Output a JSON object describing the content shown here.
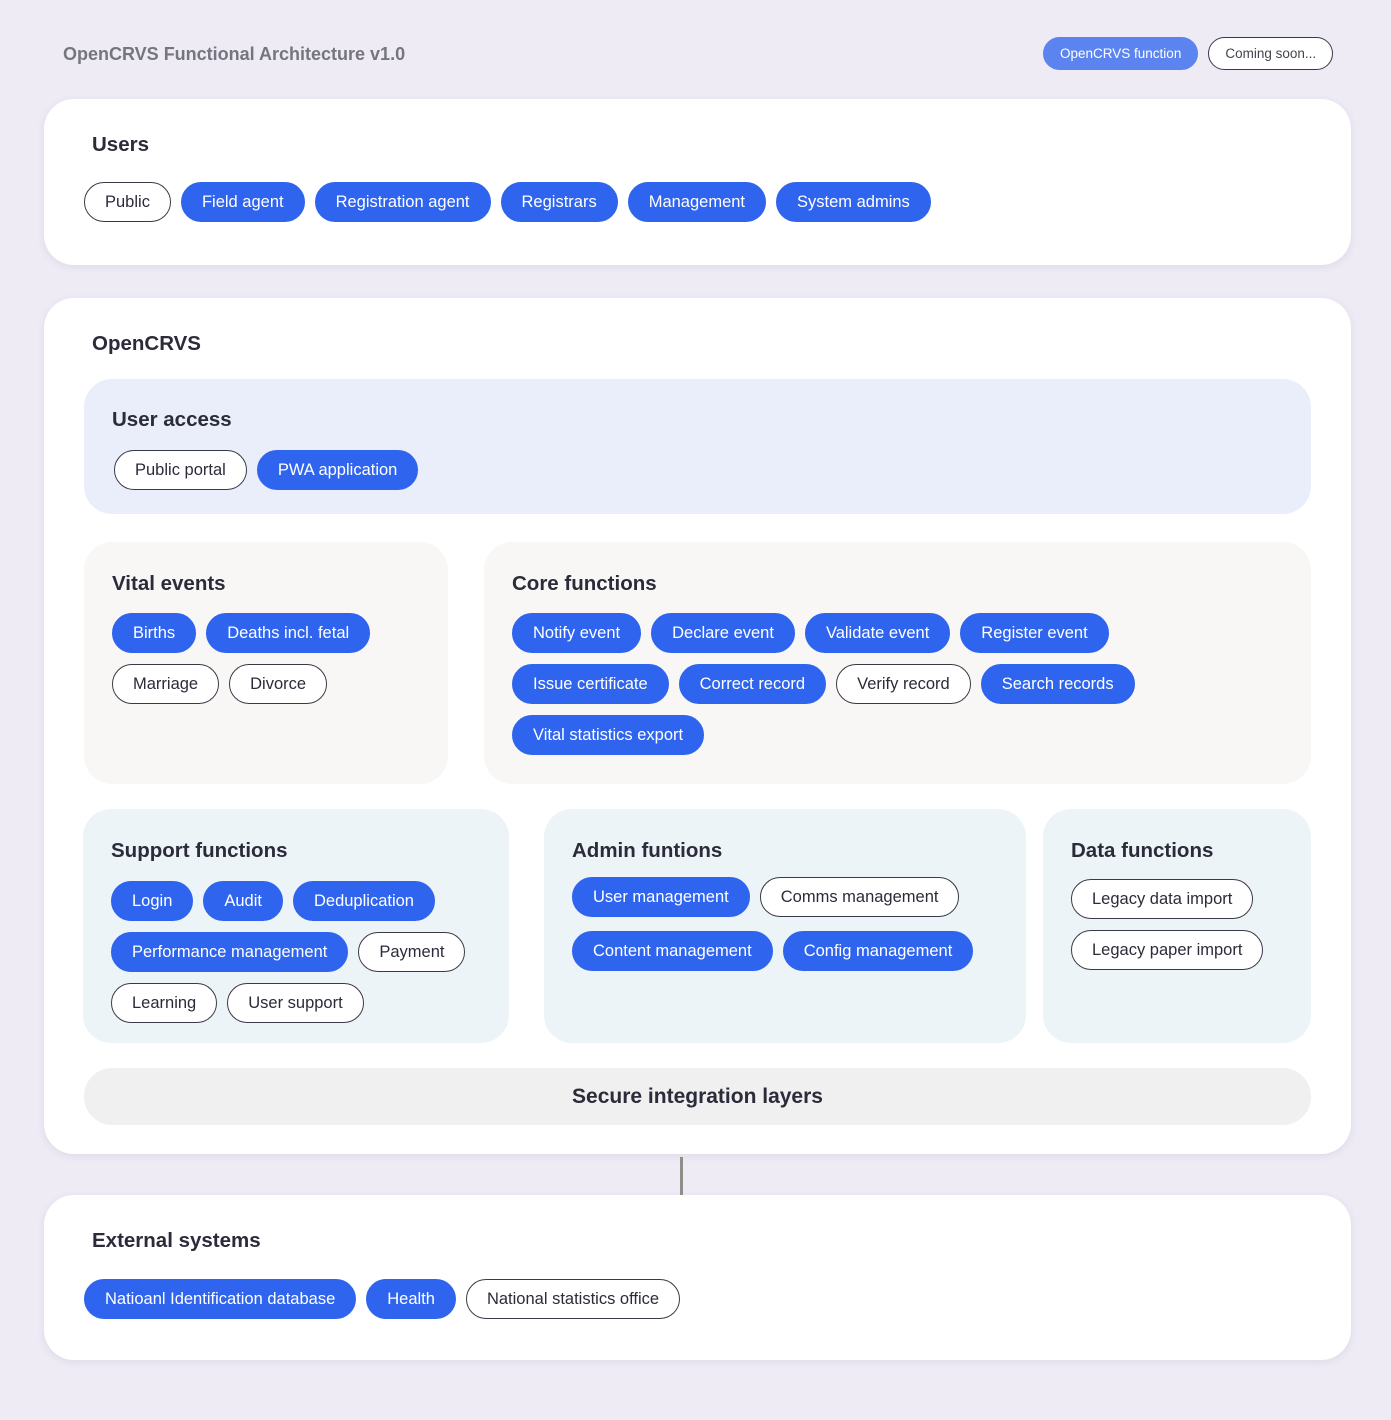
{
  "header": {
    "title": "OpenCRVS Functional Architecture v1.0",
    "legend": {
      "function_label": "OpenCRVS function",
      "coming_soon_label": "Coming soon..."
    }
  },
  "users": {
    "title": "Users",
    "items": [
      {
        "label": "Public",
        "status": "soon"
      },
      {
        "label": "Field agent",
        "status": "fn"
      },
      {
        "label": "Registration agent",
        "status": "fn"
      },
      {
        "label": "Registrars",
        "status": "fn"
      },
      {
        "label": "Management",
        "status": "fn"
      },
      {
        "label": "System admins",
        "status": "fn"
      }
    ]
  },
  "opencrvs": {
    "title": "OpenCRVS",
    "user_access": {
      "title": "User access",
      "items": [
        {
          "label": "Public portal",
          "status": "soon"
        },
        {
          "label": "PWA application",
          "status": "fn"
        }
      ]
    },
    "vital_events": {
      "title": "Vital events",
      "items": [
        {
          "label": "Births",
          "status": "fn"
        },
        {
          "label": "Deaths incl. fetal",
          "status": "fn"
        },
        {
          "label": "Marriage",
          "status": "soon"
        },
        {
          "label": "Divorce",
          "status": "soon"
        }
      ]
    },
    "core_functions": {
      "title": "Core functions",
      "items": [
        {
          "label": "Notify event",
          "status": "fn"
        },
        {
          "label": "Declare event",
          "status": "fn"
        },
        {
          "label": "Validate event",
          "status": "fn"
        },
        {
          "label": "Register event",
          "status": "fn"
        },
        {
          "label": "Issue certificate",
          "status": "fn"
        },
        {
          "label": "Correct record",
          "status": "fn"
        },
        {
          "label": "Verify record",
          "status": "soon"
        },
        {
          "label": "Search records",
          "status": "fn"
        },
        {
          "label": "Vital statistics export",
          "status": "fn"
        }
      ]
    },
    "support_functions": {
      "title": "Support functions",
      "items": [
        {
          "label": "Login",
          "status": "fn"
        },
        {
          "label": "Audit",
          "status": "fn"
        },
        {
          "label": "Deduplication",
          "status": "fn"
        },
        {
          "label": "Performance management",
          "status": "fn"
        },
        {
          "label": "Payment",
          "status": "soon"
        },
        {
          "label": "Learning",
          "status": "soon"
        },
        {
          "label": "User support",
          "status": "soon"
        }
      ]
    },
    "admin_functions": {
      "title": "Admin funtions",
      "items": [
        {
          "label": "User management",
          "status": "fn"
        },
        {
          "label": "Comms management",
          "status": "soon"
        },
        {
          "label": "Content management",
          "status": "fn"
        },
        {
          "label": "Config management",
          "status": "fn"
        }
      ]
    },
    "data_functions": {
      "title": "Data functions",
      "items": [
        {
          "label": "Legacy data import",
          "status": "soon"
        },
        {
          "label": "Legacy paper import",
          "status": "soon"
        }
      ]
    },
    "integration": {
      "label": "Secure integration layers"
    }
  },
  "external_systems": {
    "title": "External systems",
    "items": [
      {
        "label": "Natioanl Identification database",
        "status": "fn"
      },
      {
        "label": "Health",
        "status": "fn"
      },
      {
        "label": "National statistics office",
        "status": "soon"
      }
    ]
  },
  "colors": {
    "function": "#2f64ee",
    "legend_function": "#5b84f0",
    "page_background": "#eeebf5",
    "user_access_panel": "#e9eefa",
    "events_panel": "#f8f7f5",
    "support_panel": "#ecf4f8",
    "integration_panel": "#f0f0f0"
  }
}
